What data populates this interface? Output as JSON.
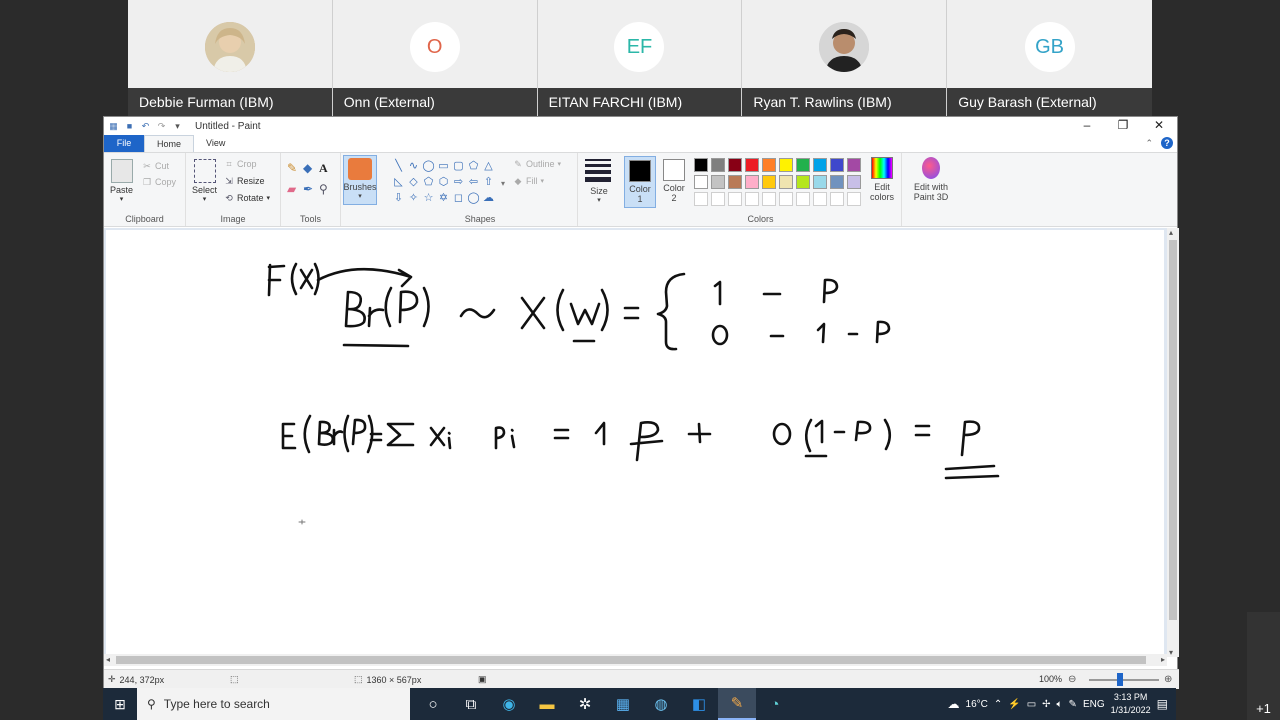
{
  "participants": [
    {
      "name": "Debbie Furman (IBM)",
      "initials": "",
      "avatar": "photo",
      "initials_color": ""
    },
    {
      "name": "Onn (External)",
      "initials": "O",
      "avatar": "initials",
      "initials_color": "#e0654a"
    },
    {
      "name": "EITAN FARCHI (IBM)",
      "initials": "EF",
      "avatar": "initials",
      "initials_color": "#2bb7a8"
    },
    {
      "name": "Ryan T. Rawlins (IBM)",
      "initials": "",
      "avatar": "photo",
      "initials_color": ""
    },
    {
      "name": "Guy Barash (External)",
      "initials": "GB",
      "avatar": "initials",
      "initials_color": "#34a3c8"
    }
  ],
  "paint": {
    "title": "Untitled - Paint",
    "tabs": {
      "file": "File",
      "home": "Home",
      "view": "View"
    },
    "clipboard": {
      "paste": "Paste",
      "cut": "Cut",
      "copy": "Copy",
      "label": "Clipboard"
    },
    "image": {
      "select": "Select",
      "crop": "Crop",
      "resize": "Resize",
      "rotate": "Rotate",
      "label": "Image"
    },
    "tools": {
      "label": "Tools"
    },
    "brushes": {
      "label": "Brushes"
    },
    "shapes": {
      "outline": "Outline",
      "fill": "Fill",
      "label": "Shapes"
    },
    "size": {
      "label": "Size"
    },
    "colors": {
      "color1": "Color\n1",
      "color2": "Color\n2",
      "label": "Colors",
      "edit_colors": "Edit\ncolors",
      "row1": [
        "#000000",
        "#7f7f7f",
        "#880015",
        "#ed1c24",
        "#ff7f27",
        "#fff200",
        "#22b14c",
        "#00a2e8",
        "#3f48cc",
        "#a349a4"
      ],
      "row2": [
        "#ffffff",
        "#c3c3c3",
        "#b97a57",
        "#ffaec9",
        "#ffc90e",
        "#efe4b0",
        "#b5e61d",
        "#99d9ea",
        "#7092be",
        "#c8bfe7"
      ],
      "row3": [
        "#ffffff",
        "#ffffff",
        "#ffffff",
        "#ffffff",
        "#ffffff",
        "#ffffff",
        "#ffffff",
        "#ffffff",
        "#ffffff",
        "#ffffff"
      ]
    },
    "paint3d": "Edit with\nPaint 3D",
    "status": {
      "cursor_pos": "244, 372px",
      "canvas_size": "1360 × 567px",
      "zoom": "100%"
    }
  },
  "taskbar": {
    "search_placeholder": "Type here to search",
    "weather": "16°C",
    "lang": "ENG",
    "time": "3:13 PM",
    "date": "1/31/2022"
  },
  "overflow_count": "+1"
}
